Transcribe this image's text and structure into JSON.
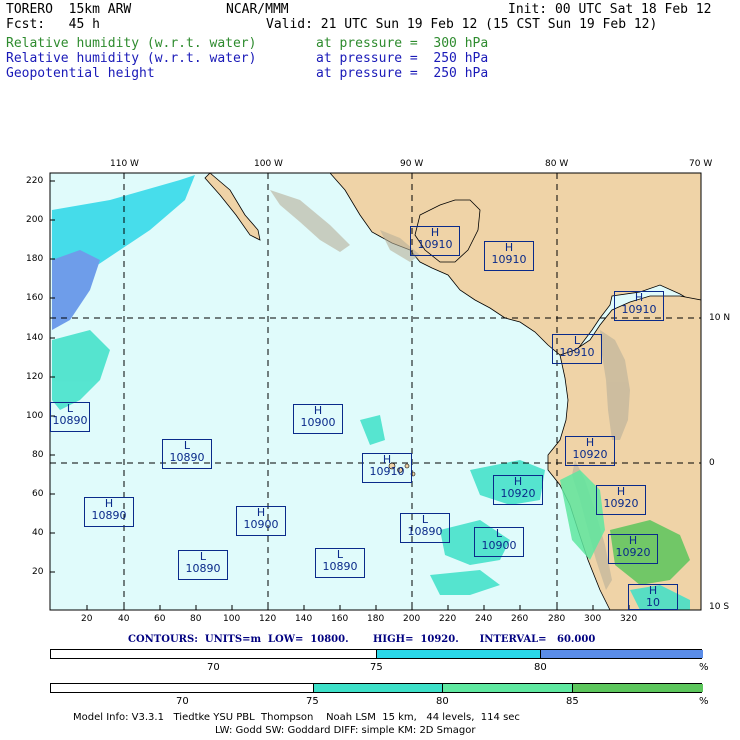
{
  "header": {
    "model": "TORERO  15km ARW",
    "org": "NCAR/MMM",
    "init": "Init: 00 UTC Sat 18 Feb 12",
    "fcst": "Fcst:   45 h",
    "valid": "Valid: 21 UTC Sun 19 Feb 12 (15 CST Sun 19 Feb 12)",
    "fields": [
      {
        "name": "Relative humidity (w.r.t. water)",
        "level": "at pressure =  300 hPa",
        "color": "#2e8b2e"
      },
      {
        "name": "Relative humidity (w.r.t. water)",
        "level": "at pressure =  250 hPa",
        "color": "#1a1ab8"
      },
      {
        "name": "Geopotential height",
        "level": "at pressure =  250 hPa",
        "color": "#1a1ab8"
      }
    ]
  },
  "map": {
    "ocean_color": "#e0fbfb",
    "land_color": "#efd3a7",
    "top_lon_labels": [
      "110 W",
      "100 W",
      "90 W",
      "80 W",
      "70 W"
    ],
    "right_lat_labels": [
      "10 N",
      "0",
      "10 S"
    ],
    "x_ticks": [
      "20",
      "40",
      "60",
      "80",
      "100",
      "120",
      "140",
      "160",
      "180",
      "200",
      "220",
      "240",
      "260",
      "280",
      "300",
      "320"
    ],
    "y_ticks": [
      "220",
      "200",
      "180",
      "160",
      "140",
      "120",
      "100",
      "80",
      "60",
      "40",
      "20"
    ],
    "height_centers": [
      {
        "type": "H",
        "value": "10910"
      },
      {
        "type": "H",
        "value": "10910"
      },
      {
        "type": "H",
        "value": "10910"
      },
      {
        "type": "L",
        "value": "10910"
      },
      {
        "type": "L",
        "value": "10890"
      },
      {
        "type": "H",
        "value": "10900"
      },
      {
        "type": "L",
        "value": "10890"
      },
      {
        "type": "H",
        "value": "10910"
      },
      {
        "type": "H",
        "value": "10920"
      },
      {
        "type": "H",
        "value": "10920"
      },
      {
        "type": "H",
        "value": "10920"
      },
      {
        "type": "H",
        "value": "10890"
      },
      {
        "type": "H",
        "value": "10900"
      },
      {
        "type": "L",
        "value": "10890"
      },
      {
        "type": "L",
        "value": "10890"
      },
      {
        "type": "L",
        "value": "10890"
      },
      {
        "type": "L",
        "value": "10900"
      },
      {
        "type": "H",
        "value": "10920"
      },
      {
        "type": "H",
        "value": "10"
      }
    ]
  },
  "contours": {
    "text": "CONTOURS:  UNITS=m  LOW=  10800.       HIGH=  10920.      INTERVAL=   60.000"
  },
  "colorbar_250": {
    "ticks": [
      "70",
      "75",
      "80"
    ],
    "unit": "%",
    "colors": [
      "#ffffff",
      "#2bd7e8",
      "#5b8de8"
    ]
  },
  "colorbar_300": {
    "ticks": [
      "70",
      "75",
      "80",
      "85"
    ],
    "unit": "%",
    "colors": [
      "#ffffff",
      "#3de0c8",
      "#5fe8a0",
      "#5cc65c"
    ]
  },
  "footer": {
    "line1": "Model Info: V3.3.1   Tiedtke YSU PBL  Thompson    Noah LSM  15 km,   44 levels,  114 sec",
    "line2": "LW: Godd SW: Goddard DIFF: simple KM: 2D Smagor"
  }
}
